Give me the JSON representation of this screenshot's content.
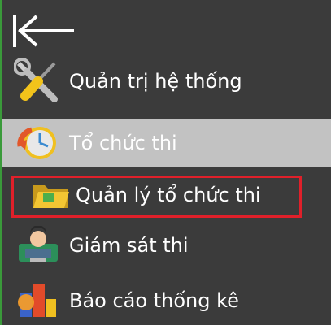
{
  "nav": {
    "back_icon": "arrow-left-bar-icon",
    "items": [
      {
        "label": "Quản trị hệ thống",
        "icon": "tools-icon"
      },
      {
        "label": "Tổ chức thi",
        "icon": "clock-refresh-icon",
        "selected": true
      },
      {
        "label": "Quản lý tổ chức thi",
        "icon": "folder-icon",
        "highlighted": true
      },
      {
        "label": "Giám sát thi",
        "icon": "monitor-user-icon"
      },
      {
        "label": "Báo cáo thống kê",
        "icon": "report-chart-icon"
      }
    ]
  },
  "colors": {
    "background": "#3b3b3b",
    "selected_background": "#c2c2c2",
    "accent_border": "#3a9a3a",
    "highlight_box": "#e0202a",
    "text": "#ffffff"
  }
}
